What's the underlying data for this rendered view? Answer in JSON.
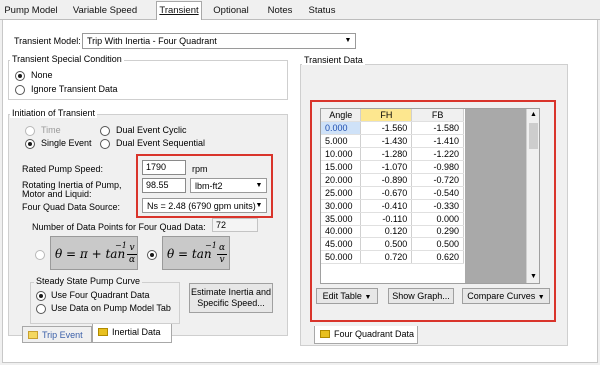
{
  "tabs": [
    "Pump Model",
    "Variable Speed",
    "Transient",
    "Optional",
    "Notes",
    "Status"
  ],
  "transient_model": {
    "label": "Transient Model:",
    "value": "Trip With Inertia - Four Quadrant"
  },
  "special_condition": {
    "title": "Transient Special Condition",
    "options": [
      "None",
      "Ignore Transient Data"
    ],
    "selected": "None"
  },
  "initiation": {
    "title": "Initiation of Transient",
    "options": [
      "Time",
      "Dual Event Cyclic",
      "Single Event",
      "Dual Event Sequential"
    ],
    "selected": "Single Event"
  },
  "rated_speed": {
    "label": "Rated Pump Speed:",
    "value": "1790",
    "unit": "rpm"
  },
  "inertia": {
    "label_line1": "Rotating Inertia of Pump,",
    "label_line2": "Motor and Liquid:",
    "value": "98.55",
    "unit": "lbm-ft2"
  },
  "four_quad_source": {
    "label": "Four Quad Data Source:",
    "value": "Ns = 2.48 (6790 gpm units)"
  },
  "data_points": {
    "label": "Number of Data Points for Four Quad Data:",
    "value": "72"
  },
  "formulas": {
    "left": {
      "lhs": "θ = π + tan",
      "sup": "−1",
      "num": "v",
      "den": "α"
    },
    "right": {
      "lhs": "θ = tan",
      "sup": "−1",
      "num": "α",
      "den": "v"
    },
    "selected": "right"
  },
  "steady_state": {
    "title": "Steady State Pump Curve",
    "options": [
      "Use Four Quadrant Data",
      "Use Data on Pump Model Tab"
    ],
    "selected": "Use Four Quadrant Data"
  },
  "estimate_button": {
    "line1": "Estimate Inertia and",
    "line2": "Specific Speed..."
  },
  "bottom_tabs_left": [
    "Trip Event",
    "Inertial Data"
  ],
  "transient_data": {
    "title": "Transient Data",
    "columns": [
      "Angle",
      "FH",
      "FB"
    ],
    "rows": [
      [
        "0.000",
        "-1.560",
        "-1.580"
      ],
      [
        "5.000",
        "-1.430",
        "-1.410"
      ],
      [
        "10.000",
        "-1.280",
        "-1.220"
      ],
      [
        "15.000",
        "-1.070",
        "-0.980"
      ],
      [
        "20.000",
        "-0.890",
        "-0.720"
      ],
      [
        "25.000",
        "-0.670",
        "-0.540"
      ],
      [
        "30.000",
        "-0.410",
        "-0.330"
      ],
      [
        "35.000",
        "-0.110",
        "0.000"
      ],
      [
        "40.000",
        "0.120",
        "0.290"
      ],
      [
        "45.000",
        "0.500",
        "0.500"
      ],
      [
        "50.000",
        "0.720",
        "0.620"
      ]
    ],
    "buttons": [
      "Edit Table",
      "Show Graph...",
      "Compare Curves"
    ],
    "bottom_tab": "Four Quadrant Data"
  },
  "colors": {
    "highlight_border": "#d9342b",
    "fh_header": "#fde78f",
    "selected_cell": "#cfe2f8"
  }
}
